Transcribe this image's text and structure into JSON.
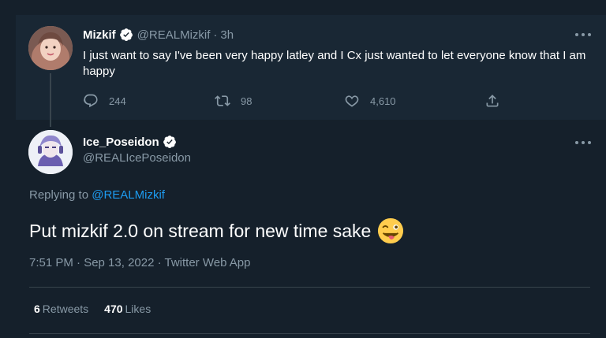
{
  "parent_tweet": {
    "display_name": "Mizkif",
    "handle": "@REALMizkif",
    "separator": "·",
    "time": "3h",
    "text": "I just want to say I've been very happy latley and I Cx just wanted to let everyone know that I am happy",
    "replies": "244",
    "retweets": "98",
    "likes": "4,610",
    "icons": [
      "verified-badge-icon",
      "reply-icon",
      "retweet-icon",
      "like-icon",
      "share-icon",
      "more-icon"
    ]
  },
  "main_tweet": {
    "display_name": "Ice_Poseidon",
    "handle": "@REALIcePoseidon",
    "replying_prefix": "Replying to",
    "replying_to": "@REALMizkif",
    "text": "Put mizkif 2.0 on stream for new time sake",
    "emoji": "winking-face-with-tongue",
    "timestamp": "7:51 PM · Sep 13, 2022 · Twitter Web App",
    "retweet_count": "6",
    "retweet_label": "Retweets",
    "like_count": "470",
    "like_label": "Likes"
  },
  "colors": {
    "background": "#15202b",
    "card": "#192734",
    "secondary_text": "#8899a6",
    "link": "#1d9bf0",
    "divider": "#38444d",
    "verified": "#ffffff"
  }
}
